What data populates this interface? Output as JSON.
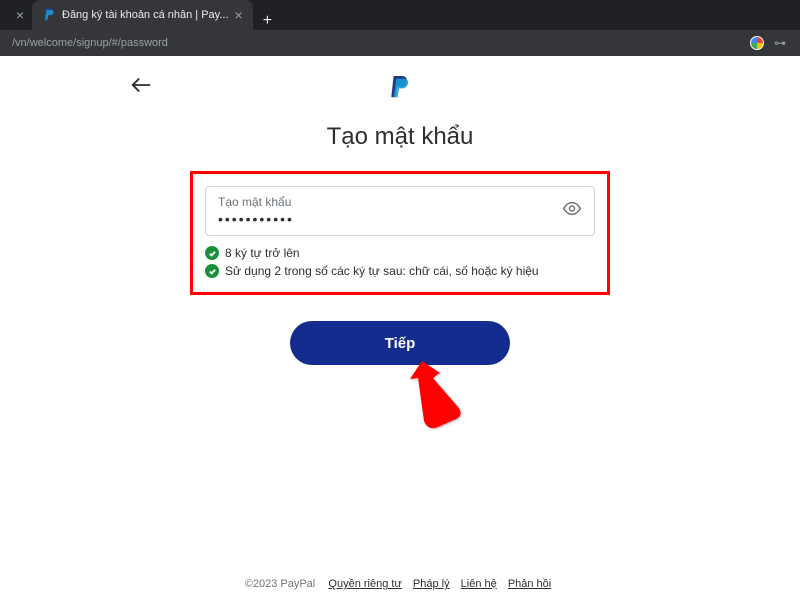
{
  "browser": {
    "tab_title": "Đăng ký tài khoản cá nhân | Pay...",
    "url": "/vn/welcome/signup/#/password"
  },
  "page": {
    "heading": "Tạo mật khẩu",
    "password_field": {
      "label": "Tạo mật khẩu",
      "value": "•••••••••••"
    },
    "requirements": {
      "req1": "8 ký tự trở lên",
      "req2": "Sử dụng 2 trong số các ký tự sau: chữ cái, số hoặc ký hiệu"
    },
    "next_button": "Tiếp"
  },
  "footer": {
    "copyright": "©2023 PayPal",
    "links": {
      "privacy": "Quyền riêng tư",
      "legal": "Pháp lý",
      "contact": "Liên hệ",
      "feedback": "Phản hồi"
    }
  }
}
